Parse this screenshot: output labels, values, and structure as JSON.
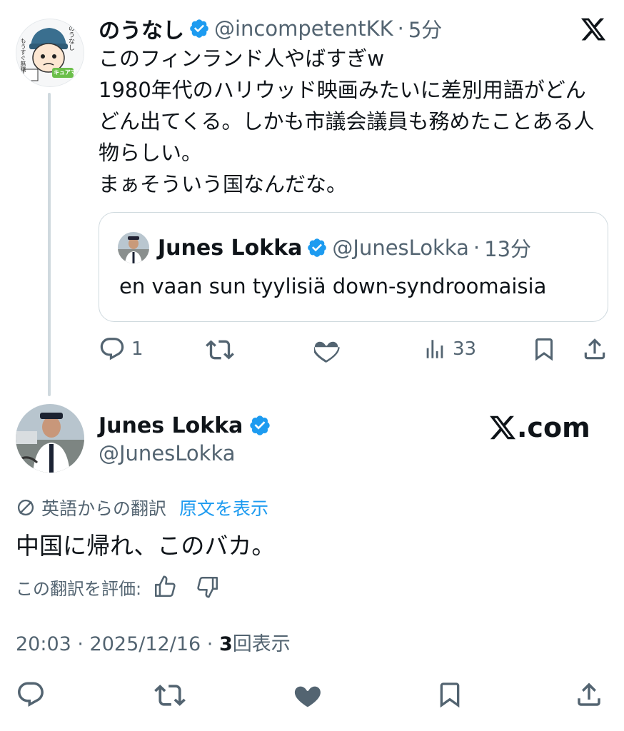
{
  "quote_tweet": {
    "author_name": "のうなし",
    "author_handle": "@incompetentKK",
    "time": "5分",
    "text": "このフィンランド人やばすぎw\n1980年代のハリウッド映画みたいに差別用語がどんどん出てくる。しかも市議会議員も務めたことある人物らしい。\nまぁそういう国なんだな。",
    "reply_count": "1",
    "view_count": "33",
    "avatar_text": [
      "のうなし",
      "もうすぐ無職",
      "キュアマン"
    ],
    "quoted": {
      "author_name": "Junes Lokka",
      "author_handle": "@JunesLokka",
      "time": "13分",
      "text": "en vaan sun tyylisiä down-syndroomaisia"
    }
  },
  "main_tweet": {
    "author_name": "Junes Lokka",
    "author_handle": "@JunesLokka",
    "site_label": ".com",
    "translation_label": "英語からの翻訳",
    "show_original": "原文を表示",
    "translated_text": "中国に帰れ、このバカ。",
    "rate_label": "この翻訳を評価:",
    "timestamp": "20:03 · 2025/12/16 · ",
    "view_number": "3",
    "view_label": "回表示"
  },
  "colors": {
    "verified": "#1d9bf0",
    "link": "#1d9bf0",
    "muted": "#536471",
    "border": "#cfd9de"
  },
  "icons": [
    "x-logo-icon",
    "verified-badge-icon",
    "reply-icon",
    "retweet-icon",
    "like-icon",
    "views-icon",
    "bookmark-icon",
    "share-icon",
    "translate-icon",
    "thumbs-up-icon",
    "thumbs-down-icon"
  ]
}
